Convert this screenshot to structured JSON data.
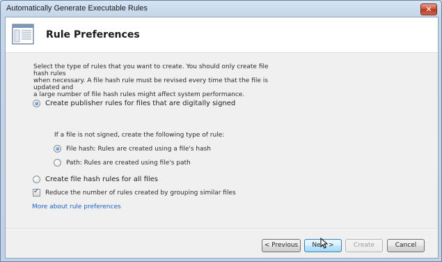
{
  "window": {
    "title": "Automatically Generate Executable Rules",
    "close_glyph": "✕"
  },
  "header": {
    "title": "Rule Preferences",
    "icon": "rule-list-icon"
  },
  "description": "Select the type of rules that you want to create. You should only create file hash rules\nwhen necessary. A file hash rule must be revised every time that the file is updated and\na large number of file hash rules might affect system performance.",
  "options": {
    "publisher_label": "Create publisher rules for files that are digitally signed",
    "publisher_selected": true,
    "unsigned_heading": "If a file is not signed, create the following type of rule:",
    "file_hash_label": "File hash: Rules are created using a file's hash",
    "file_hash_selected": true,
    "path_label": "Path: Rules are created using file's path",
    "path_selected": false,
    "hash_all_label": "Create file hash rules for all files",
    "hash_all_selected": false,
    "reduce_label": "Reduce the number of rules created by grouping similar files",
    "reduce_checked": true
  },
  "link": "More about rule preferences",
  "buttons": {
    "previous": "< Previous",
    "next": "Next >",
    "create": "Create",
    "cancel": "Cancel"
  }
}
